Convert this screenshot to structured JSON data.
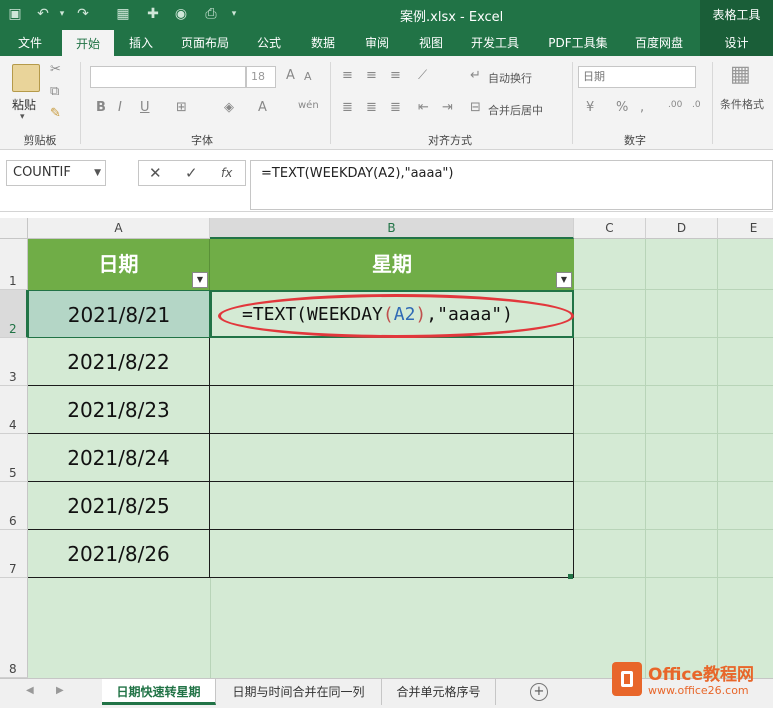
{
  "window": {
    "title": "案例.xlsx - Excel",
    "context_tab_group": "表格工具"
  },
  "ribbon_tabs": [
    "文件",
    "开始",
    "插入",
    "页面布局",
    "公式",
    "数据",
    "审阅",
    "视图",
    "开发工具",
    "PDF工具集",
    "百度网盘",
    "设计"
  ],
  "active_tab": "开始",
  "ribbon": {
    "clipboard": {
      "paste_label": "粘贴",
      "group_label": "剪贴板"
    },
    "font": {
      "font_size": "18",
      "group_label": "字体"
    },
    "alignment": {
      "wrap_label": "自动换行",
      "merge_label": "合并后居中",
      "group_label": "对齐方式"
    },
    "number": {
      "format": "日期",
      "group_label": "数字"
    },
    "styles": {
      "cond_format_label": "条件格式"
    }
  },
  "formula_bar": {
    "name_box": "COUNTIF",
    "cancel": "✕",
    "enter": "✓",
    "fx": "fx",
    "formula": "=TEXT(WEEKDAY(A2),\"aaaa\")"
  },
  "grid": {
    "columns": [
      "A",
      "B",
      "C",
      "D",
      "E"
    ],
    "rows": [
      "1",
      "2",
      "3",
      "4",
      "5",
      "6",
      "7",
      "8"
    ],
    "header_row": {
      "col_a": "日期",
      "col_b": "星期"
    },
    "dates": [
      "2021/8/21",
      "2021/8/22",
      "2021/8/23",
      "2021/8/24",
      "2021/8/25",
      "2021/8/26"
    ],
    "editing_formula": {
      "prefix": "=TEXT(WEEKDAY",
      "open_paren": "(",
      "ref": "A2",
      "close_paren": ")",
      "suffix": ",\"aaaa\")"
    }
  },
  "sheet_tabs": [
    "日期快速转星期",
    "日期与时间合并在同一列",
    "合并单元格序号"
  ],
  "active_sheet": "日期快速转星期",
  "watermark": {
    "name": "Office教程网",
    "url": "www.office26.com"
  },
  "colors": {
    "excel_green": "#217346",
    "header_fill": "#70ad47",
    "cell_fill": "#d4ead4",
    "highlight_ellipse": "#e2373c"
  }
}
